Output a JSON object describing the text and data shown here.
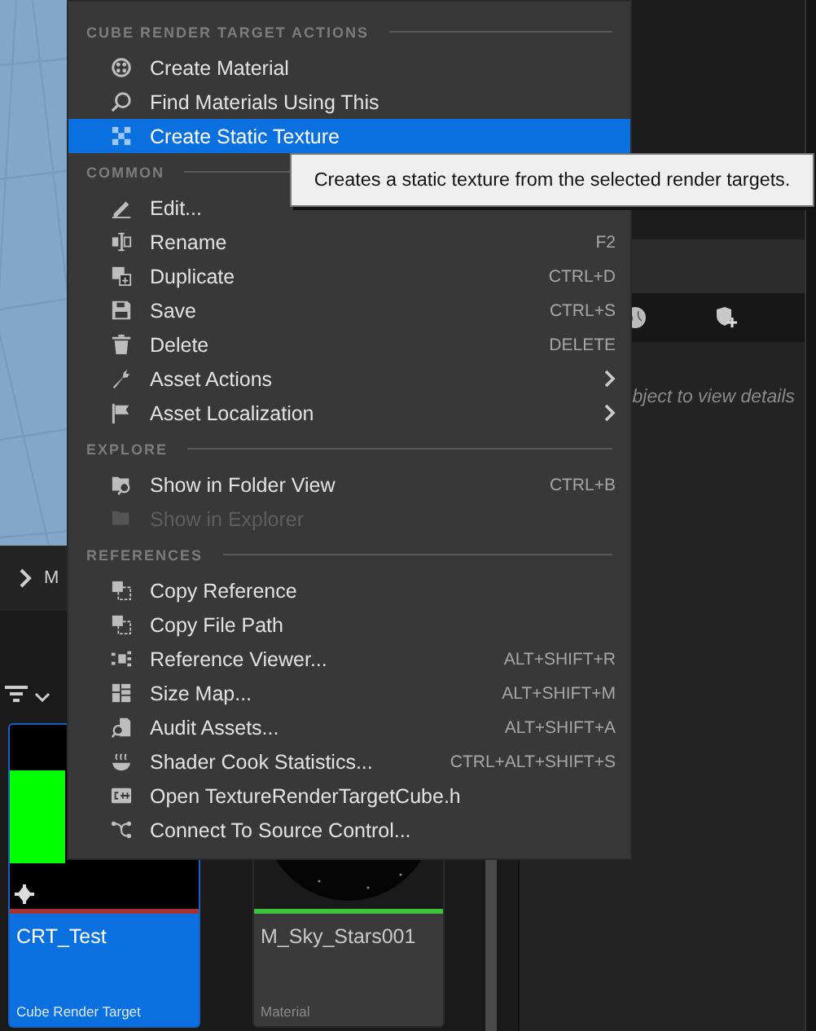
{
  "content_browser": {
    "breadcrumb": "M",
    "assets": [
      {
        "name": "CRT_Test",
        "type": "Cube Render Target",
        "selected": true,
        "color": "#a83232"
      },
      {
        "name": "M_Sky_Stars001",
        "type": "Material",
        "selected": false,
        "color": "#3cc43c"
      }
    ]
  },
  "details_panel": {
    "hint": "bject to view details"
  },
  "context_menu": {
    "sections": [
      {
        "title": "CUBE RENDER TARGET ACTIONS",
        "items": [
          {
            "label": "Create Material",
            "selected": false,
            "disabled": false,
            "submenu": false
          },
          {
            "label": "Find Materials Using This",
            "selected": false,
            "disabled": false,
            "submenu": false
          },
          {
            "label": "Create Static Texture",
            "selected": true,
            "disabled": false,
            "submenu": false
          }
        ]
      },
      {
        "title": "COMMON",
        "items": [
          {
            "label": "Edit...",
            "selected": false,
            "disabled": false,
            "submenu": false
          },
          {
            "label": "Rename",
            "shortcut": "F2",
            "selected": false,
            "disabled": false,
            "submenu": false
          },
          {
            "label": "Duplicate",
            "shortcut": "CTRL+D",
            "selected": false,
            "disabled": false,
            "submenu": false
          },
          {
            "label": "Save",
            "shortcut": "CTRL+S",
            "selected": false,
            "disabled": false,
            "submenu": false
          },
          {
            "label": "Delete",
            "shortcut": "DELETE",
            "selected": false,
            "disabled": false,
            "submenu": false
          },
          {
            "label": "Asset Actions",
            "selected": false,
            "disabled": false,
            "submenu": true
          },
          {
            "label": "Asset Localization",
            "selected": false,
            "disabled": false,
            "submenu": true
          }
        ]
      },
      {
        "title": "EXPLORE",
        "items": [
          {
            "label": "Show in Folder View",
            "shortcut": "CTRL+B",
            "selected": false,
            "disabled": false,
            "submenu": false
          },
          {
            "label": "Show in Explorer",
            "selected": false,
            "disabled": true,
            "submenu": false
          }
        ]
      },
      {
        "title": "REFERENCES",
        "items": [
          {
            "label": "Copy Reference",
            "selected": false,
            "disabled": false,
            "submenu": false
          },
          {
            "label": "Copy File Path",
            "selected": false,
            "disabled": false,
            "submenu": false
          },
          {
            "label": "Reference Viewer...",
            "shortcut": "ALT+SHIFT+R",
            "selected": false,
            "disabled": false,
            "submenu": false
          },
          {
            "label": "Size Map...",
            "shortcut": "ALT+SHIFT+M",
            "selected": false,
            "disabled": false,
            "submenu": false
          },
          {
            "label": "Audit Assets...",
            "shortcut": "ALT+SHIFT+A",
            "selected": false,
            "disabled": false,
            "submenu": false
          },
          {
            "label": "Shader Cook Statistics...",
            "shortcut": "CTRL+ALT+SHIFT+S",
            "selected": false,
            "disabled": false,
            "submenu": false
          },
          {
            "label": "Open TextureRenderTargetCube.h",
            "selected": false,
            "disabled": false,
            "submenu": false
          },
          {
            "label": "Connect To Source Control...",
            "selected": false,
            "disabled": false,
            "submenu": false
          }
        ]
      }
    ]
  },
  "tooltip": {
    "text": "Creates a static texture from the selected render targets."
  }
}
